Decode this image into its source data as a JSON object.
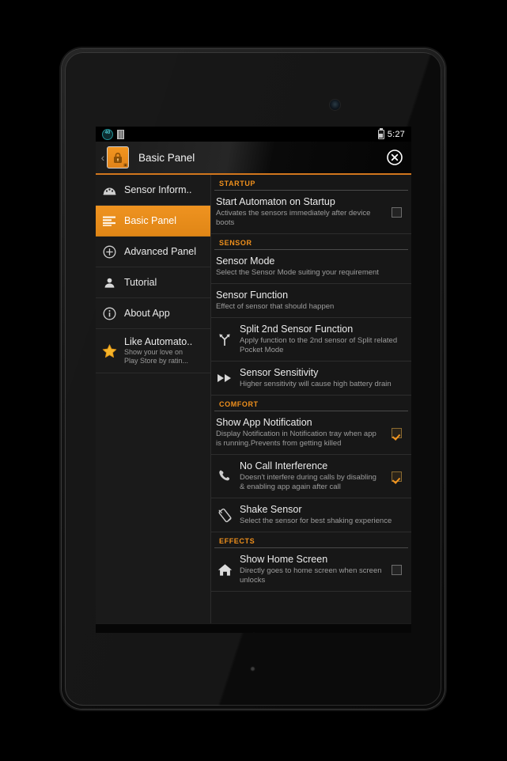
{
  "status_bar": {
    "notification_badge": "40",
    "sim_icon": "sim-card-icon",
    "battery_icon": "battery-icon",
    "time": "5:27"
  },
  "action_bar": {
    "back_icon": "back-chevron-icon",
    "app_icon": "lock-app-icon",
    "title": "Basic Panel",
    "close_icon": "close-circle-icon"
  },
  "sidebar": {
    "items": [
      {
        "label": "Sensor Inform..",
        "sub": "",
        "icon": "speedometer-icon",
        "selected": false
      },
      {
        "label": "Basic Panel",
        "sub": "",
        "icon": "list-lines-icon",
        "selected": true
      },
      {
        "label": "Advanced Panel",
        "sub": "",
        "icon": "plus-circle-icon",
        "selected": false
      },
      {
        "label": "Tutorial",
        "sub": "",
        "icon": "person-icon",
        "selected": false
      },
      {
        "label": "About App",
        "sub": "",
        "icon": "info-circle-icon",
        "selected": false
      },
      {
        "label": "Like Automato..",
        "sub": "Show your love on\nPlay Store by ratin...",
        "icon": "star-icon",
        "selected": false
      }
    ]
  },
  "preferences": {
    "sections": [
      {
        "header": "STARTUP",
        "rows": [
          {
            "icon": "",
            "title": "Start Automaton on Startup",
            "sub": "Activates the sensors immediately after device boots",
            "checkbox": "unchecked"
          }
        ]
      },
      {
        "header": "SENSOR",
        "rows": [
          {
            "icon": "",
            "title": "Sensor Mode",
            "sub": "Select the Sensor Mode suiting your requirement",
            "checkbox": "none"
          },
          {
            "icon": "",
            "title": "Sensor Function",
            "sub": "Effect of sensor that should happen",
            "checkbox": "none"
          },
          {
            "icon": "split-arrow-icon",
            "title": "Split 2nd Sensor Function",
            "sub": "Apply function to the 2nd sensor of Split related Pocket Mode",
            "checkbox": "none"
          },
          {
            "icon": "fast-forward-icon",
            "title": "Sensor Sensitivity",
            "sub": "Higher sensitivity will cause high battery drain",
            "checkbox": "none"
          }
        ]
      },
      {
        "header": "COMFORT",
        "rows": [
          {
            "icon": "",
            "title": "Show App Notification",
            "sub": "Display Notification in Notification tray when app is running.Prevents from getting killed",
            "checkbox": "checked"
          },
          {
            "icon": "phone-icon",
            "title": "No Call Interference",
            "sub": "Doesn't interfere during calls by disabling & enabling app again after call",
            "checkbox": "checked"
          },
          {
            "icon": "shake-device-icon",
            "title": "Shake Sensor",
            "sub": "Select the sensor for best shaking experience",
            "checkbox": "none"
          }
        ]
      },
      {
        "header": "EFFECTS",
        "rows": [
          {
            "icon": "home-icon",
            "title": "Show Home Screen",
            "sub": "Directly goes to home screen when screen unlocks",
            "checkbox": "unchecked"
          }
        ]
      }
    ]
  },
  "navigation_bar": {
    "back": "back-arrow-icon",
    "home": "home-nav-icon",
    "recents": "recent-apps-icon"
  },
  "colors": {
    "accent": "#ef9320",
    "section_header": "#f0901c",
    "screen_bg": "#171717",
    "sidebar_bg": "#1a1a1a"
  }
}
